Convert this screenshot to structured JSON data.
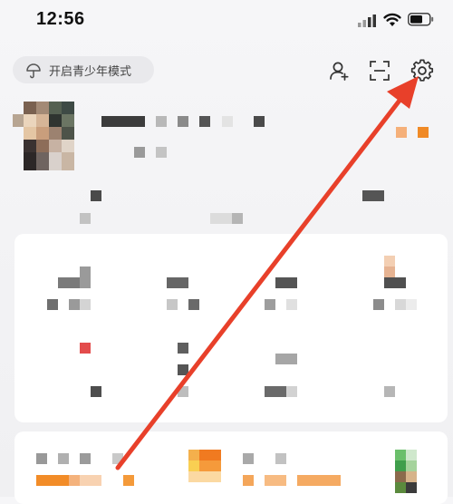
{
  "status_bar": {
    "time": "12:56",
    "signal_icon": "signal-bars-icon",
    "wifi_icon": "wifi-icon",
    "battery_icon": "battery-icon"
  },
  "header": {
    "youth_mode_label": "开启青少年模式",
    "youth_mode_icon": "umbrella-icon",
    "add_friend_icon": "add-person-icon",
    "scan_icon": "scan-icon",
    "settings_icon": "gear-icon"
  },
  "colors": {
    "annotation_arrow": "#e8402a",
    "accent_orange": "#f7931e"
  }
}
